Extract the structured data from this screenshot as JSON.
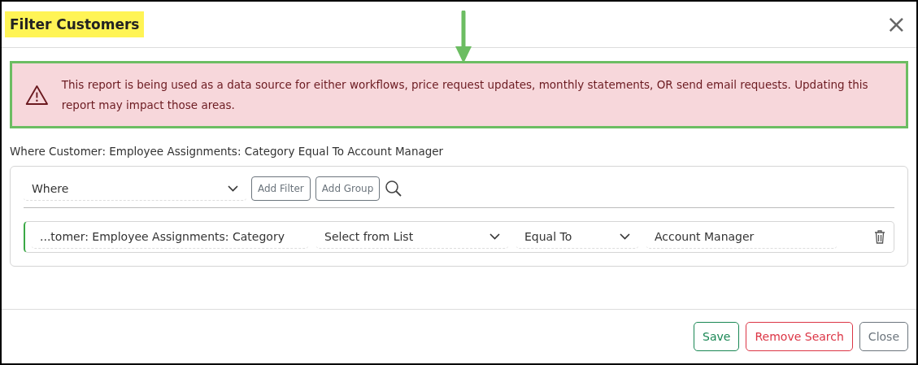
{
  "dialog": {
    "title": "Filter Customers",
    "close": "×"
  },
  "alert": {
    "message": "This report is being used as a data source for either workflows, price request updates, monthly statements, OR send email requests. Updating this report may impact those areas."
  },
  "summary": "Where Customer: Employee Assignments: Category Equal To Account Manager",
  "filter_panel": {
    "conjunction": "Where",
    "buttons": [
      "Add Filter",
      "Add Group"
    ],
    "rows": [
      {
        "field": "...tomer: Employee Assignments: Category",
        "source": "Select from List",
        "operator": "Equal To",
        "value": "Account Manager"
      }
    ]
  },
  "footer_buttons": [
    {
      "label": "Save",
      "kind": "save"
    },
    {
      "label": "Remove Search",
      "kind": "danger"
    },
    {
      "label": "Close",
      "kind": "secondary"
    }
  ]
}
